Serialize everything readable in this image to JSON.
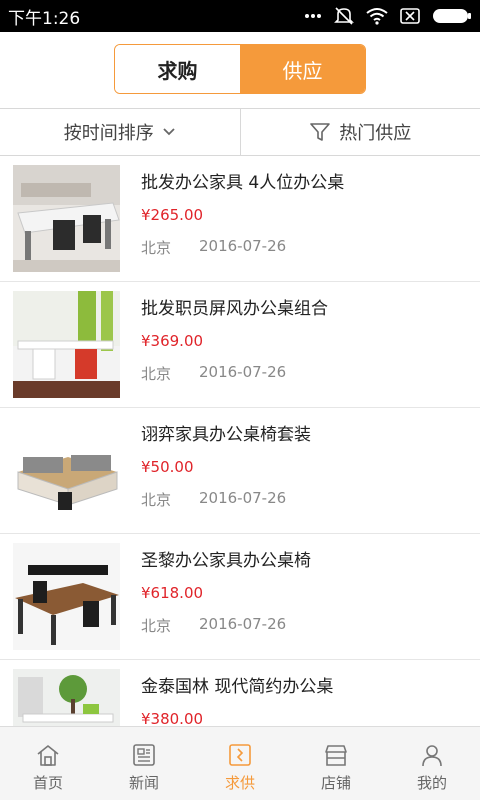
{
  "status": {
    "time": "下午1:26"
  },
  "segment": {
    "left": "求购",
    "right": "供应",
    "active": "供应"
  },
  "filters": {
    "sort": "按时间排序",
    "hot": "热门供应"
  },
  "items": [
    {
      "title": "批发办公家具 4人位办公桌",
      "price": "¥265.00",
      "city": "北京",
      "date": "2016-07-26"
    },
    {
      "title": "批发职员屏风办公桌组合",
      "price": "¥369.00",
      "city": "北京",
      "date": "2016-07-26"
    },
    {
      "title": "诩弈家具办公桌椅套装",
      "price": "¥50.00",
      "city": "北京",
      "date": "2016-07-26"
    },
    {
      "title": "圣黎办公家具办公桌椅",
      "price": "¥618.00",
      "city": "北京",
      "date": "2016-07-26"
    },
    {
      "title": "金泰国林 现代简约办公桌",
      "price": "¥380.00",
      "city": "",
      "date": ""
    }
  ],
  "tabs": [
    "首页",
    "新闻",
    "求供",
    "店铺",
    "我的"
  ],
  "active_tab": "求供",
  "colors": {
    "accent": "#f59a3b",
    "price": "#e0242a"
  }
}
